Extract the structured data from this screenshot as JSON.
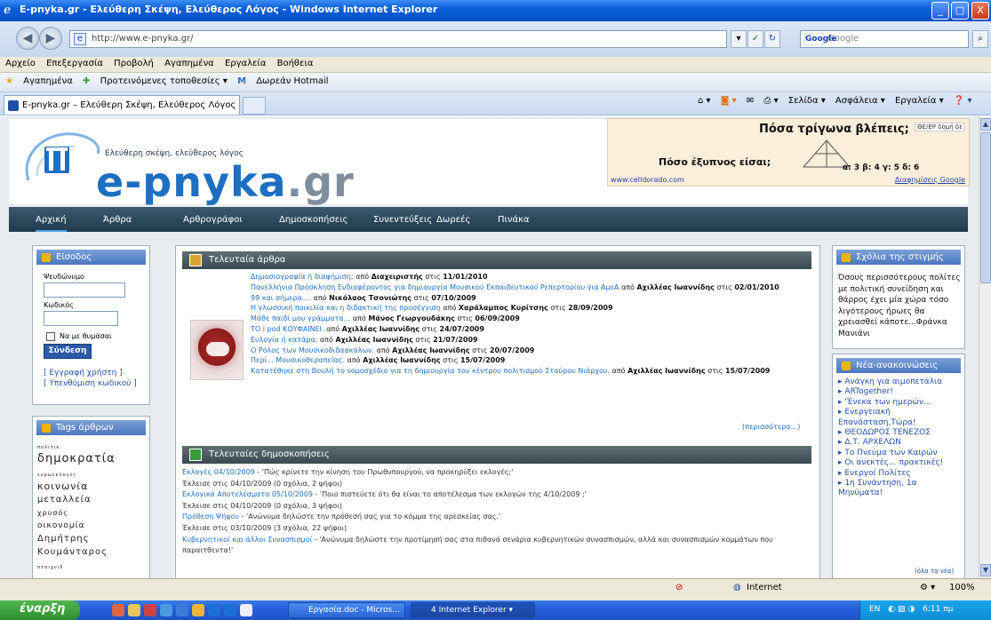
{
  "window": {
    "title": "E-pnyka.gr - Ελεύθερη Σκέψη, Ελεύθερος Λόγος - Windows Internet Explorer",
    "minimize": "_",
    "maximize": "□",
    "close": "X"
  },
  "toolbar": {
    "url": "http://www.e-pnyka.gr/",
    "search_placeholder": "Google",
    "search_logo": "Google"
  },
  "menu": [
    "Αρχείο",
    "Επεξεργασία",
    "Προβολή",
    "Αγαπημένα",
    "Εργαλεία",
    "Βοήθεια"
  ],
  "favbar": {
    "favorites": "Αγαπημένα",
    "suggested": "Προτεινόμενες τοποθεσίες ▾",
    "hotmail": "Δωρεάν Hotmail"
  },
  "tab": {
    "label": "E-pnyka.gr – Ελεύθερη Σκέψη, Ελεύθερος Λόγος"
  },
  "commandbar": [
    "Σελίδα ▾",
    "Ασφάλεια ▾",
    "Εργαλεία ▾"
  ],
  "site": {
    "slogan": "Ελεύθερη σκέψη, ελεύθερος λόγος",
    "logo_main": "e-pnyka",
    "logo_tld": ".gr"
  },
  "ad": {
    "question1": "Πόσα τρίγωνα βλέπεις;",
    "question2": "Πόσο έξυπνος είσαι;",
    "options": "α: 3   β: 4   γ: 5   δ: 6",
    "url": "www.celldorado.com",
    "adlink": "Διαφημίσεις Google",
    "badge": "ΘΕ/ΕΡ δομή δε"
  },
  "nav": [
    "Αρχική",
    "Άρθρα",
    "Αρθρογράφοι",
    "Δημοσκοπήσεις",
    "Συνεντεύξεις",
    "Δωρεές",
    "Πινάκα"
  ],
  "login": {
    "title": "Είσοδος",
    "username_label": "Ψευδώνυμο",
    "password_label": "Κωδικός",
    "remember": "Να με θυμάσαι",
    "submit": "Σύνδεση",
    "register": "[ Εγγραφή χρήστη ]",
    "forgot": "[ Υπενθύμιση κωδικού ]"
  },
  "tags": {
    "title": "Tags άρθρων",
    "items": [
      "πολιτικ",
      "δημοκρατία",
      "ευρωεκλογές",
      "κοινωνία",
      "μεταλλεία",
      "χρυσός",
      "οικονομία",
      "Δημήτρης",
      "Κουμάνταρος",
      "πταιχνιδ"
    ]
  },
  "latest_articles": {
    "title": "Τελευταία άρθρα",
    "items": [
      {
        "title": "Δημοσιογραφία ή διαφήμιση;",
        "author": "Διαχειριστής",
        "date": "11/01/2010"
      },
      {
        "title": "Πανελλήνια Πρόσκληση Ενδιαφέροντος για δημιουργία Μουσικού Εκπαιδευτικού Ρεπερτορίου για ΑμεΑ",
        "author": "Αχιλλέας Ιωαννίδης",
        "date": "02/01/2010"
      },
      {
        "title": "99 και σήμερα....",
        "author": "Νικόλαος Τσονιώτης",
        "date": "07/10/2009"
      },
      {
        "title": "Η γλωσσική ποικιλία και η διδακτική της προσέγγιση",
        "author": "Χαράλαμπος Κυρίτσης",
        "date": "28/09/2009"
      },
      {
        "title": "Μάθε παιδί μου γράμματα...",
        "author": "Μάνος Γεωργουδάκης",
        "date": "06/09/2009"
      },
      {
        "title": "ΤΟ i pod ΚΟΥΦΑΙΝΕΙ.",
        "author": "Αχιλλέας Ιωαννίδης",
        "date": "24/07/2009"
      },
      {
        "title": "Ευλογία ή κατάρα;",
        "author": "Αχιλλέας Ιωαννίδης",
        "date": "21/07/2009"
      },
      {
        "title": "Ο Ρόλος των Μουσικοδιδασκάλων.",
        "author": "Αχιλλέας Ιωαννίδης",
        "date": "20/07/2009"
      },
      {
        "title": "Περί... Μουσικοθεραπείας.",
        "author": "Αχιλλέας Ιωαννίδης",
        "date": "15/07/2009"
      },
      {
        "title": "Κατατέθηκε στη Βουλή το νομοσχέδιο για τη δημιουργία του κέντρου πολιτισμού Σταύρου Νιάρχου.",
        "author": "Αχιλλέας Ιωαννίδης",
        "date": "15/07/2009"
      }
    ],
    "by": "από",
    "on": "στις",
    "more": "(περισσότερα...)"
  },
  "latest_polls": {
    "title": "Τελευταίες δημοσκοπήσεις",
    "items": [
      {
        "link": "Εκλογές 04/10/2009",
        "question": " - 'Πώς κρίνετε την κίνηση του Πρωθυπουργού, να προκηρύξει εκλογές;'",
        "meta": "Έκλεισε στις 04/10/2009 (0 σχόλια, 2 ψήφοι)"
      },
      {
        "link": "Εκλογικά Αποτελέσματα 05/10/2009",
        "question": " - 'Ποιο πιστεύετε ότι θα είναι το αποτέλεσμα των εκλογών της 4/10/2009 ;'",
        "meta": "Έκλεισε στις 04/10/2009 (0 σχόλια, 3 ψήφοι)"
      },
      {
        "link": "Πρόθεση Ψήφου",
        "question": " - 'Ανώνυμα δηλώστε την πρόθεσή σας για το κόμμα της αρεσκείας σας.'",
        "meta": "Έκλεισε στις 03/10/2009 (3 σχόλια, 22 ψήφοι)"
      },
      {
        "link": "Κυβερνητικοί και άλλοι Συνασπισμοί",
        "question": " - 'Ανώνυμα δηλώστε την προτίμησή σας στα πιθανά σενάρια κυβερνητικών συνασπισμών, αλλά και συνασπισμών κομμάτων που παραιτθεντα!'",
        "meta": ""
      }
    ]
  },
  "comment": {
    "title": "Σχόλια της στιγμής",
    "text": "Όσους περισσότερους πολίτες με πολιτική συνείδηση και θάρρος έχει μία χώρα τόσο λιγότερους ήρωες θα χρειασθεί κάποτε...Φράνκα Μανιάνι"
  },
  "news": {
    "title": "Νέα-ανακοινώσεις",
    "items": [
      "Ανάγκη για αιμοπετάλια",
      "ARTogether!",
      "'Ένεκα των ημερών...",
      "Ενεργειακή Επανάσταση,Τώρα!",
      "ΘΕΟΔΩΡΟΣ ΤΕΝΕΖΟΣ",
      "Δ.Τ. ΑΡΧΕΛΩΝ",
      "Το Πνεύμα των Καιρών",
      "Οι ανεκτές... πρακτικές!",
      "Ενεργοί Πολίτες",
      "1η Συνάντηση, 1α Μηνύματα!"
    ],
    "all": "(όλα τα νέα)"
  },
  "statusbar": {
    "zone": "Internet",
    "zoom": "100%"
  },
  "taskbar": {
    "start": "έναρξη",
    "task1": "Εργασία.doc - Micros...",
    "task2": "4 Internet Explorer",
    "lang": "EN",
    "time": "6:11 πμ"
  }
}
